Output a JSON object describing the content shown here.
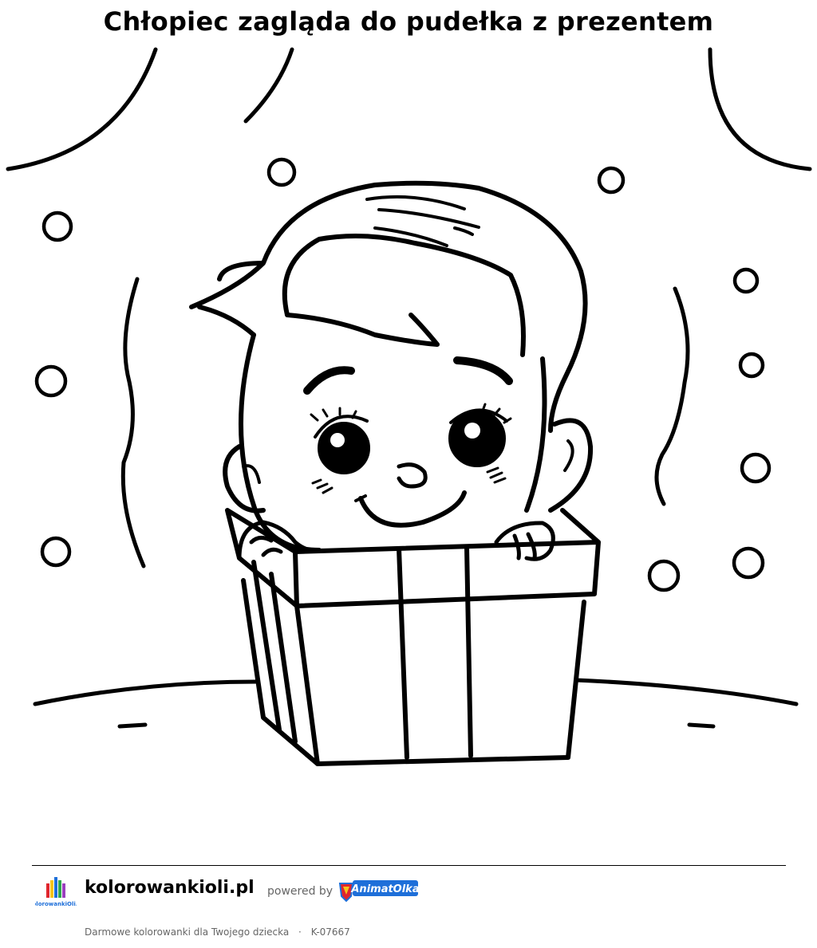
{
  "page": {
    "title": "Chłopiec zagląda do pudełka z prezentem"
  },
  "illustration": {
    "subject": "boy-peeking-into-gift-box",
    "style": "black-line-art-coloring-page"
  },
  "footer": {
    "logo_text": "KolorowankiOli.pl",
    "site_name": "kolorowankioli.pl",
    "powered_by": "powered by",
    "brand_logo_text": "AnimatOlka",
    "tagline": "Darmowe kolorowanki dla Twojego dziecka",
    "separator": "·",
    "code": "K-07667"
  },
  "colors": {
    "ink": "#000000",
    "muted_text": "#666666",
    "brand_blue": "#1e6fd9",
    "brand_red": "#e0262d",
    "brand_yellow": "#f7c41c"
  }
}
